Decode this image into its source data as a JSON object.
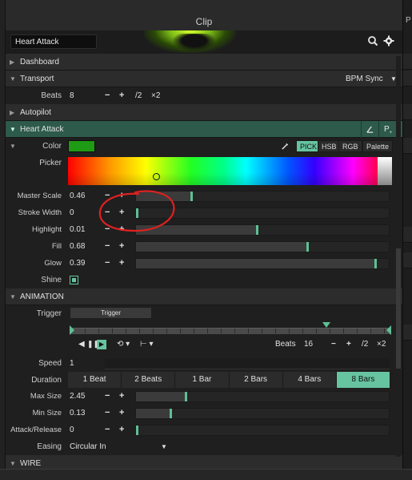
{
  "panel": {
    "title": "Clip",
    "right_title": "P"
  },
  "header": {
    "clip_name": "Heart Attack"
  },
  "sections": {
    "dashboard": "Dashboard",
    "transport": "Transport",
    "transport_mode": "BPM Sync",
    "autopilot": "Autopilot",
    "effect": "Heart Attack",
    "animation": "ANIMATION",
    "wire": "WIRE"
  },
  "beats_row": {
    "label": "Beats",
    "value": "8",
    "minus": "−",
    "plus": "+",
    "half": "/2",
    "double": "×2"
  },
  "color_row": {
    "label": "Color",
    "swatch_color": "#1f9a14",
    "pick": "PICK",
    "hsb": "HSB",
    "rgb": "RGB",
    "palette": "Palette"
  },
  "picker": {
    "label": "Picker"
  },
  "params": [
    {
      "label": "Master Scale",
      "value": "0.46",
      "level": 0.22
    },
    {
      "label": "Stroke Width",
      "value": "0",
      "level": 0.0
    },
    {
      "label": "Highlight",
      "value": "0.01",
      "level": 0.48
    },
    {
      "label": "Fill",
      "value": "0.68",
      "level": 0.68
    },
    {
      "label": "Glow",
      "value": "0.39",
      "level": 0.95
    }
  ],
  "shine": {
    "label": "Shine",
    "checked": true
  },
  "trigger": {
    "label": "Trigger",
    "button": "Trigger"
  },
  "anim_transport": {
    "beats_label": "Beats",
    "beats_value": "16",
    "minus": "−",
    "plus": "+",
    "half": "/2",
    "double": "×2"
  },
  "speed": {
    "label": "Speed",
    "value": "1"
  },
  "duration": {
    "label": "Duration",
    "options": [
      "1 Beat",
      "2 Beats",
      "1 Bar",
      "2 Bars",
      "4 Bars",
      "8 Bars"
    ],
    "selected": "8 Bars"
  },
  "anim_params": [
    {
      "label": "Max Size",
      "value": "2.45",
      "level": 0.2
    },
    {
      "label": "Min Size",
      "value": "0.13",
      "level": 0.14
    },
    {
      "label": "Attack/Release",
      "value": "0",
      "level": 0.0
    }
  ],
  "easing": {
    "label": "Easing",
    "value": "Circular In"
  },
  "accent_color": "#67c4a0",
  "annotation_color": "#e02020"
}
